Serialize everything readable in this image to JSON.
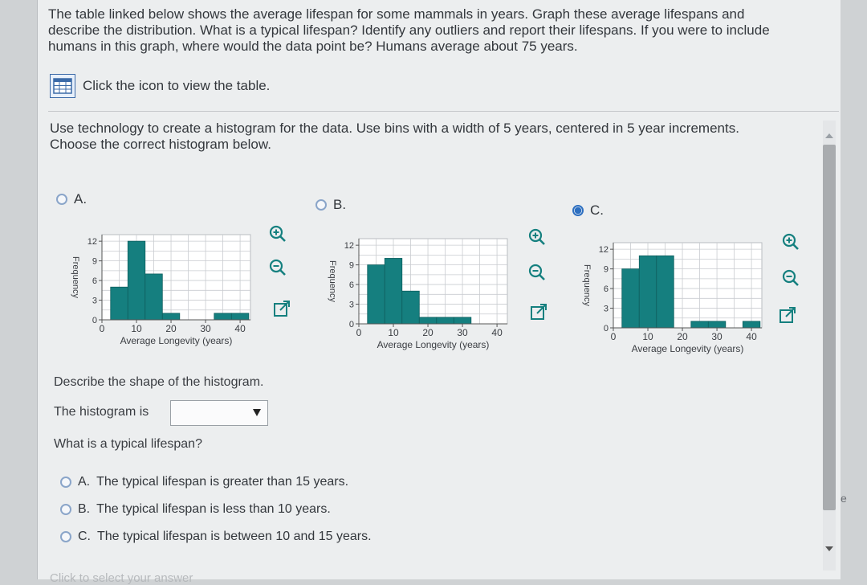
{
  "prompt": {
    "lines": [
      "The table linked below shows the average lifespan for some mammals in years. Graph these average lifespans and",
      "describe the distribution. What is a typical lifespan? Identify any outliers and report their lifespans. If you were to include",
      "humans in this graph, where would the data point be? Humans average about 75 years."
    ],
    "table_link_label": "Click the icon to view the table."
  },
  "question1": {
    "lines": [
      "Use technology to create a histogram for the data. Use bins with a width of 5 years, centered in 5 year increments.",
      "Choose the correct histogram below."
    ],
    "options": [
      {
        "letter": "A.",
        "selected": false
      },
      {
        "letter": "B.",
        "selected": false
      },
      {
        "letter": "C.",
        "selected": true
      }
    ]
  },
  "chart_data": [
    {
      "type": "bar",
      "option": "A",
      "xlabel": "Average Longevity (years)",
      "ylabel": "Frequency",
      "x_ticks": [
        "0",
        "10",
        "20",
        "30",
        "40"
      ],
      "y_ticks": [
        "0",
        "3",
        "6",
        "9",
        "12"
      ],
      "ylim": [
        0,
        13
      ],
      "xlim": [
        0,
        43
      ],
      "bars": [
        {
          "x_start": 2.5,
          "x_end": 7.5,
          "value": 5
        },
        {
          "x_start": 7.5,
          "x_end": 12.5,
          "value": 12
        },
        {
          "x_start": 12.5,
          "x_end": 17.5,
          "value": 7
        },
        {
          "x_start": 17.5,
          "x_end": 22.5,
          "value": 1
        },
        {
          "x_start": 22.5,
          "x_end": 27.5,
          "value": 0
        },
        {
          "x_start": 27.5,
          "x_end": 32.5,
          "value": 0
        },
        {
          "x_start": 32.5,
          "x_end": 37.5,
          "value": 1
        },
        {
          "x_start": 37.5,
          "x_end": 42.5,
          "value": 1
        }
      ]
    },
    {
      "type": "bar",
      "option": "B",
      "xlabel": "Average Longevity (years)",
      "ylabel": "Frequency",
      "x_ticks": [
        "0",
        "10",
        "20",
        "30",
        "40"
      ],
      "y_ticks": [
        "0",
        "3",
        "6",
        "9",
        "12"
      ],
      "ylim": [
        0,
        13
      ],
      "xlim": [
        0,
        43
      ],
      "bars": [
        {
          "x_start": 2.5,
          "x_end": 7.5,
          "value": 9
        },
        {
          "x_start": 7.5,
          "x_end": 12.5,
          "value": 10
        },
        {
          "x_start": 12.5,
          "x_end": 17.5,
          "value": 5
        },
        {
          "x_start": 17.5,
          "x_end": 22.5,
          "value": 1
        },
        {
          "x_start": 22.5,
          "x_end": 27.5,
          "value": 1
        },
        {
          "x_start": 27.5,
          "x_end": 32.5,
          "value": 1
        },
        {
          "x_start": 32.5,
          "x_end": 37.5,
          "value": 0
        },
        {
          "x_start": 37.5,
          "x_end": 42.5,
          "value": 0
        }
      ]
    },
    {
      "type": "bar",
      "option": "C",
      "xlabel": "Average Longevity (years)",
      "ylabel": "Frequency",
      "x_ticks": [
        "0",
        "10",
        "20",
        "30",
        "40"
      ],
      "y_ticks": [
        "0",
        "3",
        "6",
        "9",
        "12"
      ],
      "ylim": [
        0,
        13
      ],
      "xlim": [
        0,
        43
      ],
      "bars": [
        {
          "x_start": 2.5,
          "x_end": 7.5,
          "value": 9
        },
        {
          "x_start": 7.5,
          "x_end": 12.5,
          "value": 11
        },
        {
          "x_start": 12.5,
          "x_end": 17.5,
          "value": 11
        },
        {
          "x_start": 17.5,
          "x_end": 22.5,
          "value": 0
        },
        {
          "x_start": 22.5,
          "x_end": 27.5,
          "value": 1
        },
        {
          "x_start": 27.5,
          "x_end": 32.5,
          "value": 1
        },
        {
          "x_start": 32.5,
          "x_end": 37.5,
          "value": 0
        },
        {
          "x_start": 37.5,
          "x_end": 42.5,
          "value": 1
        }
      ]
    }
  ],
  "shape_question": {
    "prompt": "Describe the shape of the histogram.",
    "sentence_prefix": "The histogram is",
    "dropdown_value": ""
  },
  "typical_question": {
    "prompt": "What is a typical lifespan?",
    "options": [
      {
        "letter": "A.",
        "text": "The typical lifespan is greater than 15 years.",
        "selected": false
      },
      {
        "letter": "B.",
        "text": "The typical lifespan is less than 10 years.",
        "selected": false
      },
      {
        "letter": "C.",
        "text": "The typical lifespan is between 10 and 15 years.",
        "selected": false
      }
    ]
  },
  "footer_text": "Click to select your answer",
  "side_letter": "e",
  "colors": {
    "bar_fill": "#157f7f",
    "bar_stroke": "#0f5f5f",
    "grid": "#c9ccd0",
    "radio_selected": "#2d6fc0"
  },
  "icons": [
    "table-icon",
    "zoom-in-icon",
    "zoom-out-icon",
    "external-link-icon"
  ]
}
